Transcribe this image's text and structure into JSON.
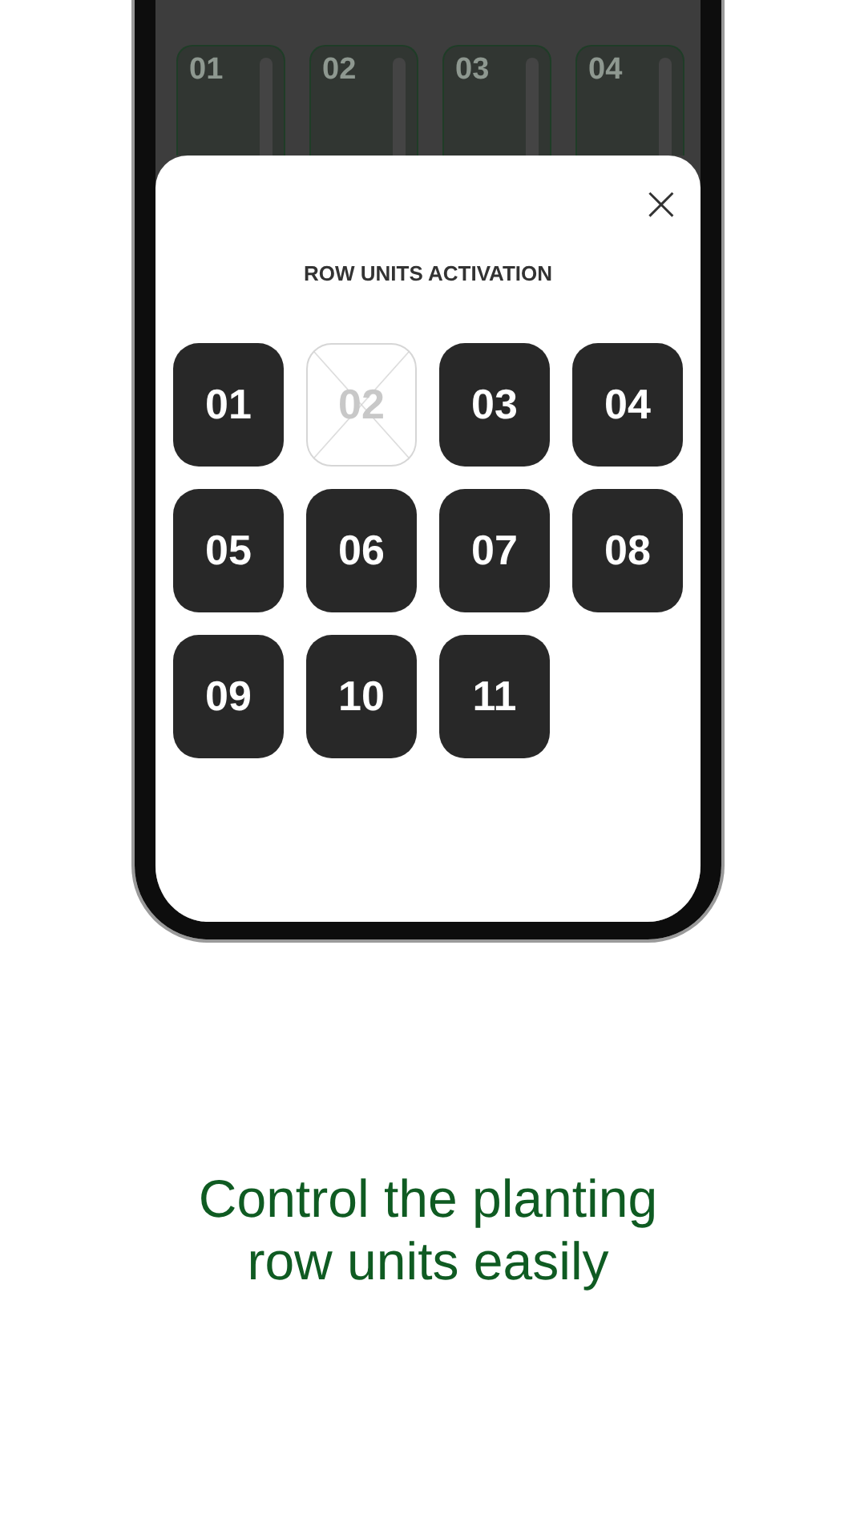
{
  "background_tiles": [
    {
      "label": "01"
    },
    {
      "label": "02"
    },
    {
      "label": "03"
    },
    {
      "label": "04"
    }
  ],
  "modal": {
    "close": "×",
    "title": "ROW UNITS ACTIVATION",
    "units": [
      {
        "label": "01",
        "active": true
      },
      {
        "label": "02",
        "active": false
      },
      {
        "label": "03",
        "active": true
      },
      {
        "label": "04",
        "active": true
      },
      {
        "label": "05",
        "active": true
      },
      {
        "label": "06",
        "active": true
      },
      {
        "label": "07",
        "active": true
      },
      {
        "label": "08",
        "active": true
      },
      {
        "label": "09",
        "active": true
      },
      {
        "label": "10",
        "active": true
      },
      {
        "label": "11",
        "active": true
      }
    ]
  },
  "tagline": "Control the planting row units easily"
}
